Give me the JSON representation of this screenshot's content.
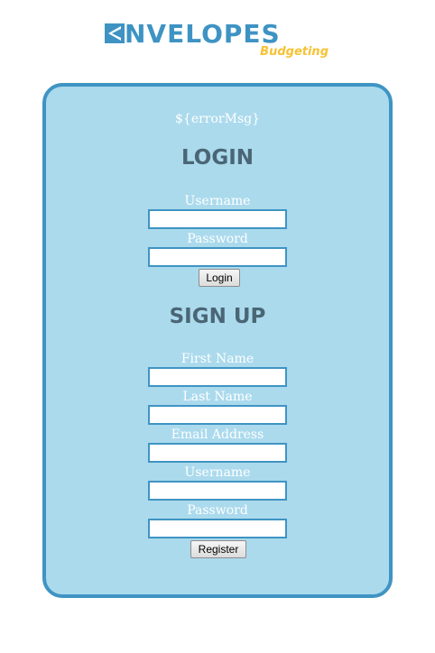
{
  "brand": {
    "name": "NVELOPES",
    "tagline": "Budgeting",
    "color": "#3e93c3",
    "accent": "#f7c232"
  },
  "error_message": "${errorMsg}",
  "login": {
    "heading": "LOGIN",
    "username_label": "Username",
    "password_label": "Password",
    "username_value": "",
    "password_value": "",
    "button_label": "Login"
  },
  "signup": {
    "heading": "SIGN UP",
    "first_name_label": "First Name",
    "last_name_label": "Last Name",
    "email_label": "Email Address",
    "username_label": "Username",
    "password_label": "Password",
    "button_label": "Register"
  },
  "colors": {
    "card_bg": "#abdaed",
    "card_border": "#3f94c3",
    "heading": "#4a6675"
  }
}
